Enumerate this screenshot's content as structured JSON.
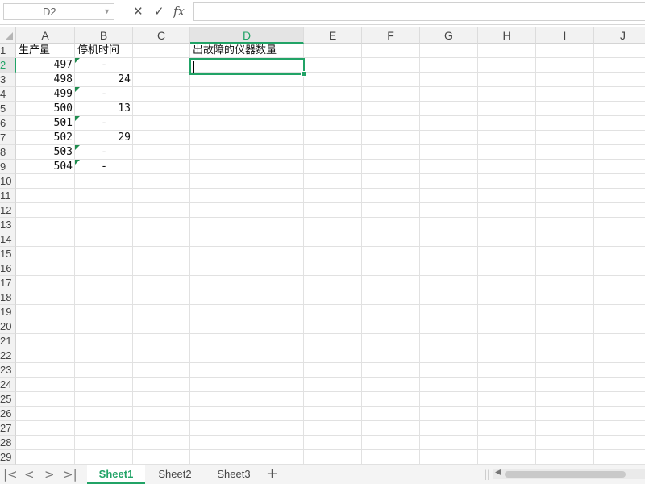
{
  "formula_bar": {
    "name_box": "D2",
    "cancel_icon": "✕",
    "confirm_icon": "✓",
    "fx_label": "fx",
    "formula": ""
  },
  "columns": [
    "A",
    "B",
    "C",
    "D",
    "E",
    "F",
    "G",
    "H",
    "I",
    "J"
  ],
  "rows": [
    "1",
    "2",
    "3",
    "4",
    "5",
    "6",
    "7",
    "8",
    "9",
    "10",
    "11",
    "12",
    "13",
    "14",
    "15",
    "16",
    "17",
    "18",
    "19",
    "20",
    "21",
    "22",
    "23",
    "24",
    "25",
    "26",
    "27",
    "28",
    "29"
  ],
  "active_cell": {
    "column": "D",
    "row": "2"
  },
  "cells": {
    "A1": "生产量",
    "B1": "停机时间",
    "D1": "出故障的仪器数量",
    "A2": "497",
    "B2": "-",
    "A3": "498",
    "B3": "24",
    "A4": "499",
    "B4": "-",
    "A5": "500",
    "B5": "13",
    "A6": "501",
    "B6": "-",
    "A7": "502",
    "B7": "29",
    "A8": "503",
    "B8": "-",
    "A9": "504",
    "B9": "-"
  },
  "sheet_tabs": [
    "Sheet1",
    "Sheet2",
    "Sheet3"
  ],
  "active_sheet": "Sheet1",
  "nav_icons": [
    "first-sheet-icon",
    "prev-sheet-icon",
    "next-sheet-icon",
    "last-sheet-icon"
  ],
  "add_sheet": "+",
  "accent_color": "#21a366"
}
